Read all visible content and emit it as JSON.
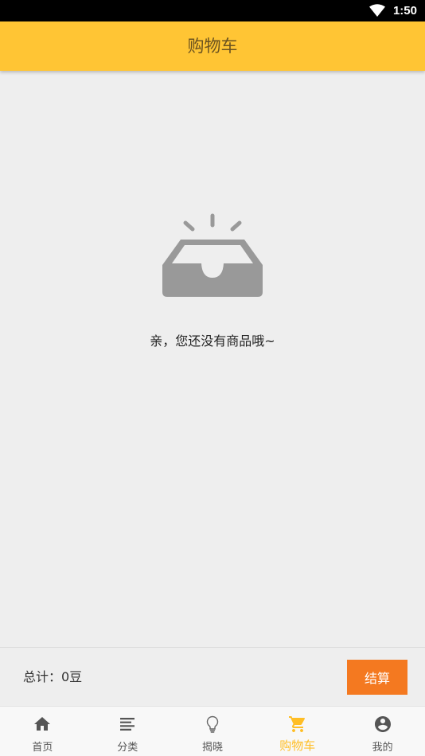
{
  "status_bar": {
    "time": "1:50"
  },
  "header": {
    "title": "购物车"
  },
  "empty_state": {
    "message": "亲，您还没有商品哦~",
    "icon": "empty-inbox-icon"
  },
  "footer": {
    "total_label": "总计：0豆",
    "checkout_label": "结算"
  },
  "tabs": [
    {
      "label": "首页",
      "icon": "home-icon",
      "active": false
    },
    {
      "label": "分类",
      "icon": "list-icon",
      "active": false
    },
    {
      "label": "揭晓",
      "icon": "lightbulb-icon",
      "active": false
    },
    {
      "label": "购物车",
      "icon": "cart-icon",
      "active": true
    },
    {
      "label": "我的",
      "icon": "account-icon",
      "active": false
    }
  ],
  "colors": {
    "accent": "#ffc534",
    "checkout": "#f47920",
    "active_tab": "#ffbe26",
    "icon_gray": "#999999"
  }
}
